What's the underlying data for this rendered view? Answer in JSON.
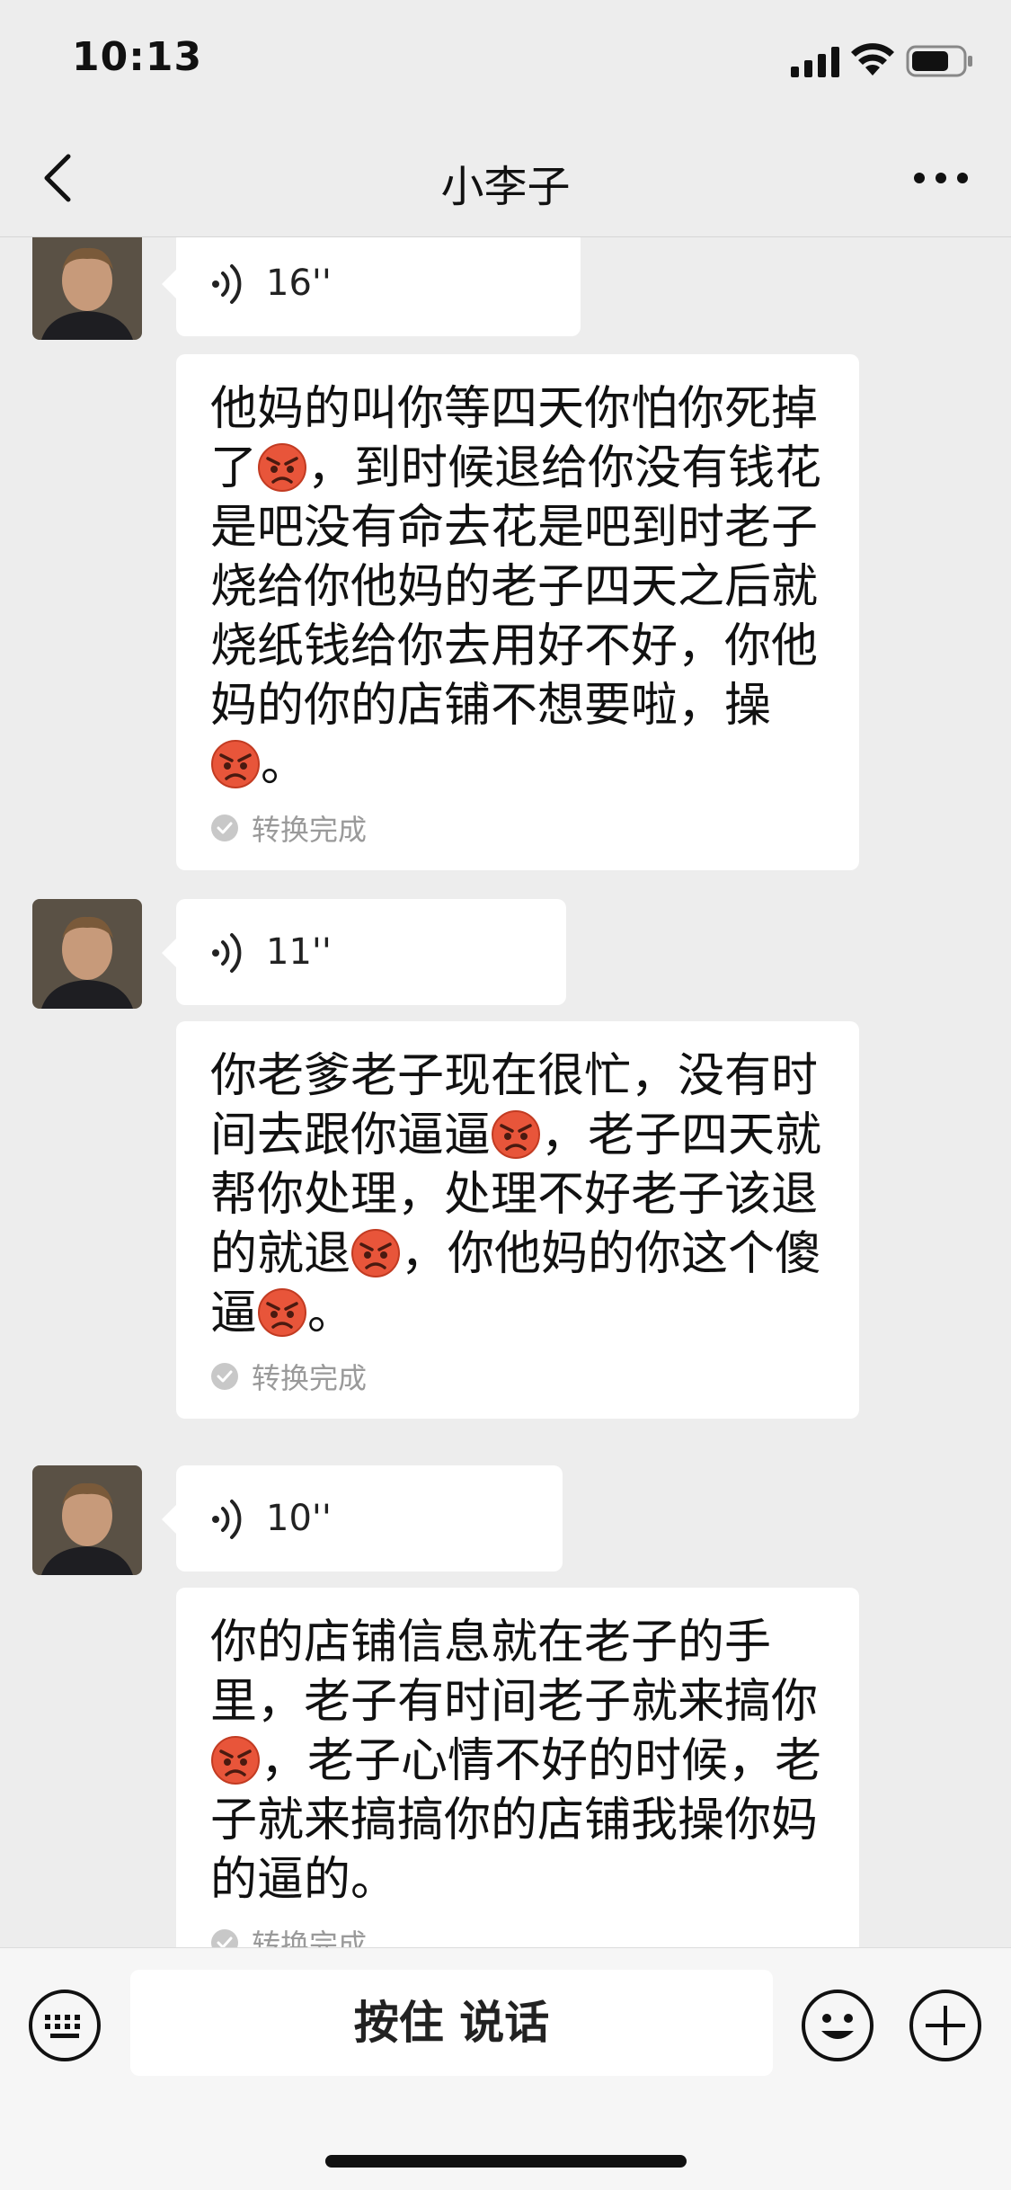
{
  "status_bar": {
    "time": "10:13"
  },
  "nav": {
    "title": "小李子"
  },
  "messages": [
    {
      "duration": "16''",
      "lines": [
        [
          {
            "t": "他妈的叫你等四天你怕你死掉"
          }
        ],
        [
          {
            "t": "了"
          },
          {
            "e": "angry-face-icon"
          },
          {
            "t": "，到时候退给你没有钱花"
          }
        ],
        [
          {
            "t": "是吧没有命去花是吧到时老子"
          }
        ],
        [
          {
            "t": "烧给你他妈的老子四天之后就"
          }
        ],
        [
          {
            "t": "烧纸钱给你去用好不好，你他"
          }
        ],
        [
          {
            "t": "妈的你的店铺不想要啦，操"
          }
        ],
        [
          {
            "e": "angry-face-icon"
          },
          {
            "t": "。"
          }
        ]
      ],
      "status": "转换完成"
    },
    {
      "duration": "11''",
      "lines": [
        [
          {
            "t": "你老爹老子现在很忙，没有时"
          }
        ],
        [
          {
            "t": "间去跟你逼逼"
          },
          {
            "e": "angry-face-icon"
          },
          {
            "t": "，老子四天就"
          }
        ],
        [
          {
            "t": "帮你处理，处理不好老子该退"
          }
        ],
        [
          {
            "t": "的就退"
          },
          {
            "e": "angry-face-icon"
          },
          {
            "t": "，你他妈的你这个傻"
          }
        ],
        [
          {
            "t": "逼"
          },
          {
            "e": "angry-face-icon"
          },
          {
            "t": "。"
          }
        ]
      ],
      "status": "转换完成"
    },
    {
      "duration": "10''",
      "lines": [
        [
          {
            "t": "你的店铺信息就在老子的手"
          }
        ],
        [
          {
            "t": "里，老子有时间老子就来搞你"
          }
        ],
        [
          {
            "e": "angry-face-icon"
          },
          {
            "t": "，老子心情不好的时候，老"
          }
        ],
        [
          {
            "t": "子就来搞搞你的店铺我操你妈"
          }
        ],
        [
          {
            "t": "的逼的。"
          }
        ]
      ],
      "status": "转换完成"
    }
  ],
  "input_bar": {
    "talk_label": "按住 说话"
  },
  "colors": {
    "background": "#ededed",
    "bubble": "#ffffff",
    "status_text": "#9a9a9a"
  }
}
